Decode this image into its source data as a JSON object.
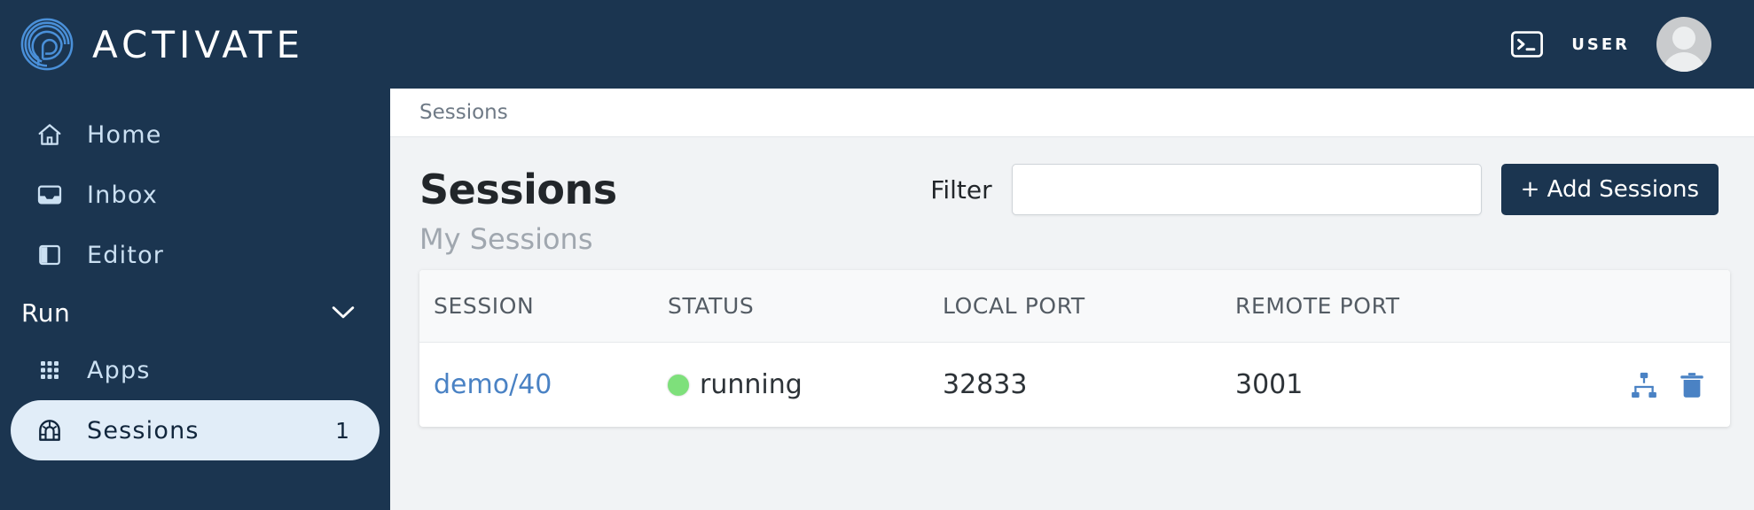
{
  "header": {
    "brand_name": "ACTIVATE",
    "logo_icon": "activate-spiral-logo",
    "terminal_icon": "terminal-icon",
    "user_label": "USER",
    "avatar_icon": "user-avatar"
  },
  "sidebar": {
    "items": [
      {
        "label": "Home",
        "icon": "home-icon",
        "active": false
      },
      {
        "label": "Inbox",
        "icon": "inbox-icon",
        "active": false
      },
      {
        "label": "Editor",
        "icon": "editor-icon",
        "active": false
      }
    ],
    "section": {
      "label": "Run",
      "chevron_icon": "chevron-down-icon",
      "items": [
        {
          "label": "Apps",
          "icon": "grid-apps-icon",
          "active": false,
          "badge": ""
        },
        {
          "label": "Sessions",
          "icon": "tunnel-icon",
          "active": true,
          "badge": "1"
        }
      ]
    }
  },
  "breadcrumb": {
    "items": [
      "Sessions"
    ]
  },
  "page": {
    "title": "Sessions",
    "subtitle": "My Sessions",
    "filter_label": "Filter",
    "filter_value": "",
    "filter_placeholder": "",
    "add_button_label": "+ Add Sessions"
  },
  "table": {
    "columns": [
      "SESSION",
      "STATUS",
      "LOCAL PORT",
      "REMOTE PORT"
    ],
    "rows": [
      {
        "session": "demo/40",
        "status": "running",
        "status_color": "#7ee07b",
        "local_port": "32833",
        "remote_port": "3001",
        "actions": [
          "sitemap-icon",
          "trash-icon"
        ]
      }
    ]
  },
  "colors": {
    "navy": "#1b3550",
    "link_blue": "#4a82c4",
    "active_pill": "#e1edf8",
    "status_green": "#7ee07b",
    "page_bg": "#f1f3f5"
  }
}
